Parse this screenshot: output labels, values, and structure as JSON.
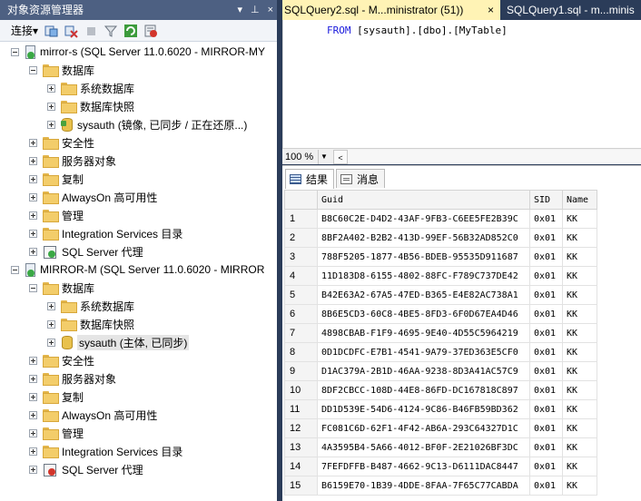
{
  "object_explorer": {
    "title": "对象资源管理器",
    "title_buttons": [
      "▾",
      "⊥",
      "×"
    ],
    "connect_label": "连接▾",
    "tree": [
      {
        "label": "mirror-s (SQL Server 11.0.6020 - MIRROR-MY",
        "icon": "server-icon",
        "expander": "minus",
        "level": 0
      },
      {
        "label": "数据库",
        "icon": "folder-icon",
        "expander": "minus",
        "level": 1
      },
      {
        "label": "系统数据库",
        "icon": "folder-icon",
        "expander": "plus",
        "level": 2
      },
      {
        "label": "数据库快照",
        "icon": "folder-icon",
        "expander": "plus",
        "level": 2
      },
      {
        "label": "sysauth (镜像, 已同步 / 正在还原...)",
        "icon": "database-mirror-icon",
        "expander": "plus",
        "level": 2
      },
      {
        "label": "安全性",
        "icon": "folder-icon",
        "expander": "plus",
        "level": 1
      },
      {
        "label": "服务器对象",
        "icon": "folder-icon",
        "expander": "plus",
        "level": 1
      },
      {
        "label": "复制",
        "icon": "folder-icon",
        "expander": "plus",
        "level": 1
      },
      {
        "label": "AlwaysOn 高可用性",
        "icon": "folder-icon",
        "expander": "plus",
        "level": 1
      },
      {
        "label": "管理",
        "icon": "folder-icon",
        "expander": "plus",
        "level": 1
      },
      {
        "label": "Integration Services 目录",
        "icon": "folder-icon",
        "expander": "plus",
        "level": 1
      },
      {
        "label": "SQL Server 代理",
        "icon": "agent-running-icon",
        "expander": "plus",
        "level": 1
      },
      {
        "label": "MIRROR-M (SQL Server 11.0.6020 - MIRROR",
        "icon": "server-icon",
        "expander": "minus",
        "level": 0
      },
      {
        "label": "数据库",
        "icon": "folder-icon",
        "expander": "minus",
        "level": 1
      },
      {
        "label": "系统数据库",
        "icon": "folder-icon",
        "expander": "plus",
        "level": 2
      },
      {
        "label": "数据库快照",
        "icon": "folder-icon",
        "expander": "plus",
        "level": 2
      },
      {
        "label": "sysauth (主体, 已同步)",
        "icon": "database-icon",
        "expander": "plus",
        "level": 2,
        "selected": true
      },
      {
        "label": "安全性",
        "icon": "folder-icon",
        "expander": "plus",
        "level": 1
      },
      {
        "label": "服务器对象",
        "icon": "folder-icon",
        "expander": "plus",
        "level": 1
      },
      {
        "label": "复制",
        "icon": "folder-icon",
        "expander": "plus",
        "level": 1
      },
      {
        "label": "AlwaysOn 高可用性",
        "icon": "folder-icon",
        "expander": "plus",
        "level": 1
      },
      {
        "label": "管理",
        "icon": "folder-icon",
        "expander": "plus",
        "level": 1
      },
      {
        "label": "Integration Services 目录",
        "icon": "folder-icon",
        "expander": "plus",
        "level": 1
      },
      {
        "label": "SQL Server 代理",
        "icon": "agent-stopped-icon",
        "expander": "plus",
        "level": 1
      }
    ]
  },
  "editor": {
    "tabs": [
      {
        "label": "SQLQuery2.sql - M...ministrator (51))",
        "active": true,
        "close": "×"
      },
      {
        "label": "SQLQuery1.sql - m...minis",
        "active": false
      }
    ],
    "code": {
      "keyword": "FROM",
      "rest": " [sysauth].[dbo].[MyTable]"
    },
    "zoom": "100 %",
    "zoom_arrow": "▼",
    "scroll_left": "<"
  },
  "results": {
    "tabs": [
      {
        "label": "结果",
        "icon": "grid-icon"
      },
      {
        "label": "消息",
        "icon": "message-icon"
      }
    ],
    "columns": [
      "",
      "Guid",
      "SID",
      "Name"
    ],
    "rows": [
      [
        "1",
        "B8C60C2E-D4D2-43AF-9FB3-C6EE5FE2B39C",
        "0x01",
        "KK"
      ],
      [
        "2",
        "8BF2A402-B2B2-413D-99EF-56B32AD852C0",
        "0x01",
        "KK"
      ],
      [
        "3",
        "788F5205-1877-4B56-BDEB-95535D911687",
        "0x01",
        "KK"
      ],
      [
        "4",
        "11D183D8-6155-4802-88FC-F789C737DE42",
        "0x01",
        "KK"
      ],
      [
        "5",
        "B42E63A2-67A5-47ED-B365-E4E82AC738A1",
        "0x01",
        "KK"
      ],
      [
        "6",
        "8B6E5CD3-60C8-4BE5-8FD3-6F0D67EA4D46",
        "0x01",
        "KK"
      ],
      [
        "7",
        "4898CBAB-F1F9-4695-9E40-4D55C5964219",
        "0x01",
        "KK"
      ],
      [
        "8",
        "0D1DCDFC-E7B1-4541-9A79-37ED363E5CF0",
        "0x01",
        "KK"
      ],
      [
        "9",
        "D1AC379A-2B1D-46AA-9238-8D3A41AC57C9",
        "0x01",
        "KK"
      ],
      [
        "10",
        "8DF2CBCC-108D-44E8-86FD-DC167818C897",
        "0x01",
        "KK"
      ],
      [
        "11",
        "DD1D539E-54D6-4124-9C86-B46FB59BD362",
        "0x01",
        "KK"
      ],
      [
        "12",
        "FC081C6D-62F1-4F42-AB6A-293C64327D1C",
        "0x01",
        "KK"
      ],
      [
        "13",
        "4A3595B4-5A66-4012-BF0F-2E21026BF3DC",
        "0x01",
        "KK"
      ],
      [
        "14",
        "7FEFDFFB-B487-4662-9C13-D6111DAC8447",
        "0x01",
        "KK"
      ],
      [
        "15",
        "B6159E70-1B39-4DDE-8FAA-7F65C77CABDA",
        "0x01",
        "KK"
      ]
    ]
  }
}
